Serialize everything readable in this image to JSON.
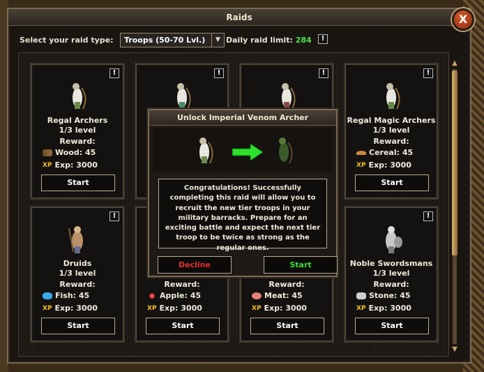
{
  "window": {
    "title": "Raids",
    "close_label": "X"
  },
  "filter": {
    "label": "Select your raid type:",
    "selected": "Troops (50-70 Lvl.)",
    "limit_label": "Daily raid limit:",
    "limit_value": "284",
    "info": "!"
  },
  "cards": [
    {
      "name": "Regal Archers",
      "level": "1/3 level",
      "reward": "Reward:",
      "resource": "Wood: 45",
      "exp": "Exp: 3000",
      "start": "Start",
      "info": "!"
    },
    {
      "name": "",
      "level": "",
      "reward": "",
      "resource": "",
      "exp": "",
      "start": "",
      "info": "!"
    },
    {
      "name": "",
      "level": "",
      "reward": "",
      "resource": "",
      "exp": "",
      "start": "",
      "info": "!"
    },
    {
      "name": "Regal Magic Archers",
      "level": "1/3 level",
      "reward": "Reward:",
      "resource": "Cereal: 45",
      "exp": "Exp: 3000",
      "start": "Start",
      "info": "!"
    },
    {
      "name": "Druids",
      "level": "1/3 level",
      "reward": "Reward:",
      "resource": "Fish: 45",
      "exp": "Exp: 3000",
      "start": "Start",
      "info": "!"
    },
    {
      "name": "",
      "level": "",
      "reward": "Reward:",
      "resource": "Apple: 45",
      "exp": "Exp: 3000",
      "start": "Start",
      "info": "!"
    },
    {
      "name": "",
      "level": "",
      "reward": "Reward:",
      "resource": "Meat: 45",
      "exp": "Exp: 3000",
      "start": "Start",
      "info": "!"
    },
    {
      "name": "Noble Swordsmans",
      "level": "1/3 level",
      "reward": "Reward:",
      "resource": "Stone: 45",
      "exp": "Exp: 3000",
      "start": "Start",
      "info": "!"
    }
  ],
  "xp_badge": "XP",
  "modal": {
    "title": "Unlock Imperial Venom Archer",
    "message": "Congratulations! Successfully completing this raid will allow you to recruit the new tier troops in your military barracks. Prepare for an exciting battle and expect the next tier troop to be twice as strong as the regular ones.",
    "decline": "Decline",
    "start": "Start"
  },
  "colors": {
    "accent_green": "#38e038",
    "decline_red": "#e33030",
    "xp_gold": "#f2c128"
  }
}
